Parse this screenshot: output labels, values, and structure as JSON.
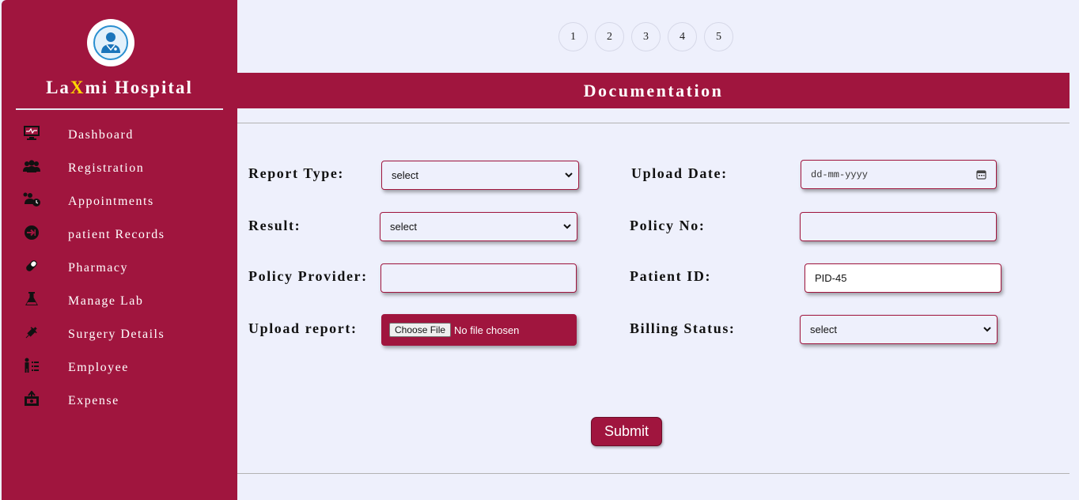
{
  "brand": {
    "prefix": "La",
    "accent": "X",
    "suffix": "mi Hospital"
  },
  "nav": [
    {
      "label": "Dashboard",
      "icon": "monitor-icon"
    },
    {
      "label": "Registration",
      "icon": "users-icon"
    },
    {
      "label": "Appointments",
      "icon": "user-clock-icon"
    },
    {
      "label": "patient Records",
      "icon": "sign-in-icon"
    },
    {
      "label": "Pharmacy",
      "icon": "pill-icon"
    },
    {
      "label": "Manage Lab",
      "icon": "flask-icon"
    },
    {
      "label": "Surgery Details",
      "icon": "syringe-icon"
    },
    {
      "label": "Employee",
      "icon": "person-chart-icon"
    },
    {
      "label": "Expense",
      "icon": "money-icon"
    }
  ],
  "pager": [
    "1",
    "2",
    "3",
    "4",
    "5"
  ],
  "banner": "Documentation",
  "form": {
    "report_type": {
      "label": "Report Type:",
      "value": "select"
    },
    "upload_date": {
      "label": "Upload Date:",
      "placeholder": "dd-mm-yyyy"
    },
    "result": {
      "label": "Result:",
      "value": "select"
    },
    "policy_no": {
      "label": "Policy No:",
      "value": ""
    },
    "policy_provider": {
      "label": "Policy Provider:",
      "value": ""
    },
    "patient_id": {
      "label": "Patient ID:",
      "value": "PID-45"
    },
    "upload_report": {
      "label": "Upload report:",
      "button": "Choose File",
      "status": "No file chosen"
    },
    "billing_status": {
      "label": "Billing Status:",
      "value": "select"
    }
  },
  "submit": "Submit",
  "colors": {
    "brand": "#a0153e",
    "accent": "#ffd700",
    "background": "#eef0fc"
  }
}
